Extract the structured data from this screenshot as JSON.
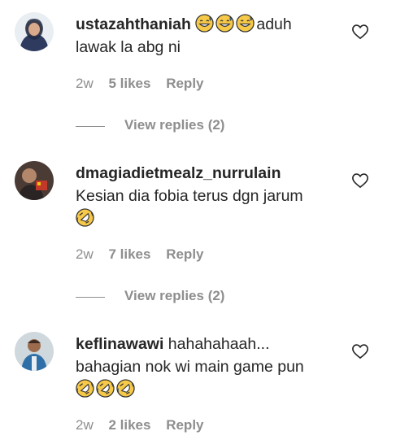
{
  "comments": [
    {
      "username": "ustazahthaniah",
      "text_after_emoji": "aduh",
      "text_line2": "lawak la abg ni",
      "time": "2w",
      "likes": "5 likes",
      "reply": "Reply",
      "view_replies": "View replies (2)",
      "emoji": [
        "grinning-sweat-icon",
        "grinning-sweat-icon",
        "grinning-sweat-icon"
      ]
    },
    {
      "username": "dmagiadietmealz_nurrulain",
      "text": "Kesian dia fobia terus dgn jarum",
      "time": "2w",
      "likes": "7 likes",
      "reply": "Reply",
      "view_replies": "View replies (2)",
      "emoji": [
        "rolling-laughing-icon"
      ]
    },
    {
      "username": "keflinawawi",
      "text_line1": "hahahahaah...",
      "text_line2": "bahagian nok wi main game pun",
      "time": "2w",
      "likes": "2 likes",
      "reply": "Reply",
      "emoji": [
        "rolling-laughing-icon",
        "rolling-laughing-icon",
        "rolling-laughing-icon"
      ]
    }
  ],
  "colors": {
    "text": "#262626",
    "muted": "#8e8e8e",
    "emoji": "#f7c948"
  }
}
